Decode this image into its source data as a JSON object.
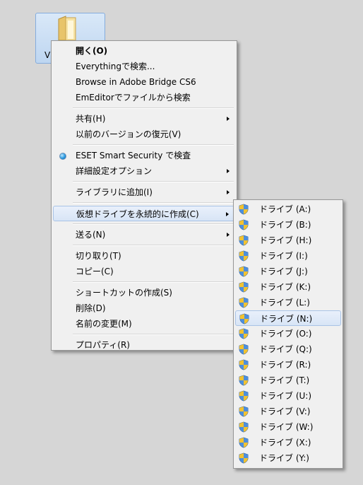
{
  "desktop": {
    "icon_label": "VI",
    "icon_name": "folder-icon"
  },
  "context_menu": {
    "groups": [
      [
        {
          "label": "開く(O)",
          "bold": true
        },
        {
          "label": "Everythingで検索..."
        },
        {
          "label": "Browse in Adobe Bridge CS6"
        },
        {
          "label": "EmEditorでファイルから検索"
        }
      ],
      [
        {
          "label": "共有(H)",
          "submenu": true
        },
        {
          "label": "以前のバージョンの復元(V)"
        }
      ],
      [
        {
          "label": "ESET Smart Security で検査",
          "icon": "radio-icon"
        },
        {
          "label": "詳細設定オプション",
          "submenu": true
        }
      ],
      [
        {
          "label": "ライブラリに追加(I)",
          "submenu": true
        }
      ],
      [
        {
          "label": "仮想ドライブを永続的に作成(C)",
          "submenu": true,
          "highlighted": true
        }
      ],
      [
        {
          "label": "送る(N)",
          "submenu": true
        }
      ],
      [
        {
          "label": "切り取り(T)"
        },
        {
          "label": "コピー(C)"
        }
      ],
      [
        {
          "label": "ショートカットの作成(S)"
        },
        {
          "label": "削除(D)"
        },
        {
          "label": "名前の変更(M)"
        }
      ],
      [
        {
          "label": "プロパティ(R)"
        }
      ]
    ]
  },
  "submenu": {
    "icon_name": "uac-shield-icon",
    "highlighted_index": 4,
    "items": [
      "ドライブ (A:)",
      "ドライブ (B:)",
      "ドライブ (H:)",
      "ドライブ (I:)",
      "ドライブ (J:)",
      "ドライブ (K:)",
      "ドライブ (L:)",
      "ドライブ (N:)",
      "ドライブ (O:)",
      "ドライブ (Q:)",
      "ドライブ (R:)",
      "ドライブ (T:)",
      "ドライブ (U:)",
      "ドライブ (V:)",
      "ドライブ (W:)",
      "ドライブ (X:)",
      "ドライブ (Y:)"
    ]
  },
  "colors": {
    "highlight_bg": "#d8e5f6",
    "highlight_border": "#a9c3e6",
    "menu_bg": "#f0f0f0"
  }
}
